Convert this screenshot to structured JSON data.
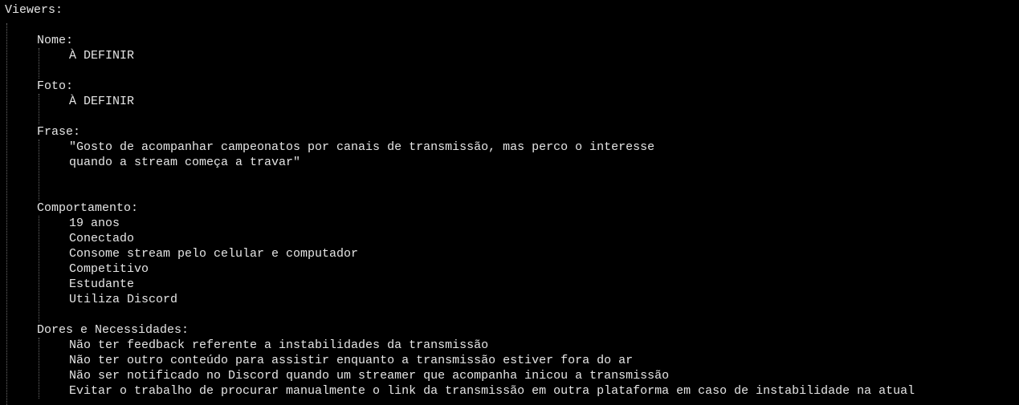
{
  "document": {
    "title": "Viewers:",
    "sections": [
      {
        "heading": "Nome:",
        "lines": [
          "À DEFINIR"
        ],
        "trailing_blank": 1
      },
      {
        "heading": "Foto:",
        "lines": [
          "À DEFINIR"
        ],
        "trailing_blank": 1
      },
      {
        "heading": "Frase:",
        "lines": [
          "\"Gosto de acompanhar campeonatos por canais de transmissão, mas perco o interesse",
          "quando a stream começa a travar\""
        ],
        "trailing_blank": 2
      },
      {
        "heading": "Comportamento:",
        "lines": [
          "19 anos",
          "Conectado",
          "Consome stream pelo celular e computador",
          "Competitivo",
          "Estudante",
          "Utiliza Discord"
        ],
        "trailing_blank": 1
      },
      {
        "heading": "Dores e Necessidades:",
        "lines": [
          "Não ter feedback referente a instabilidades da transmissão",
          "Não ter outro conteúdo para assistir enquanto a transmissão estiver fora do ar",
          "Não ser notificado no Discord quando um streamer que acompanha inicou a transmissão",
          "Evitar o trabalho de procurar manualmente o link da transmissão em outra plataforma em caso de instabilidade na atual"
        ],
        "trailing_blank": 0
      }
    ]
  }
}
